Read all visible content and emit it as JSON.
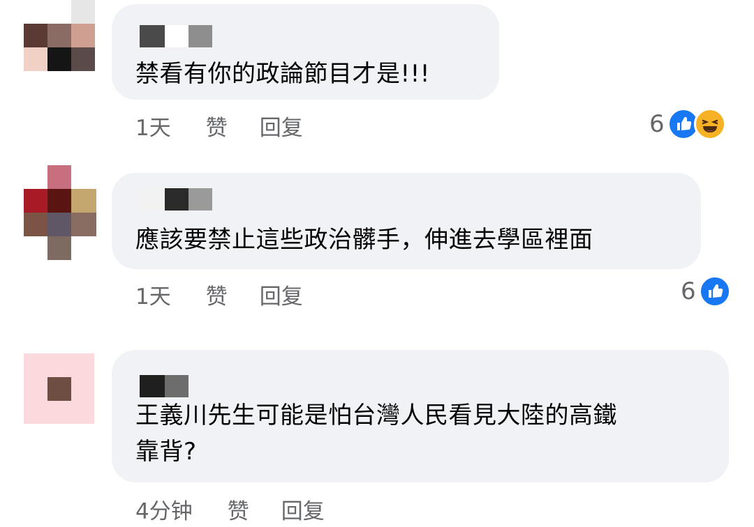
{
  "comments": [
    {
      "text": "禁看有你的政論節目才是!!!",
      "time": "1天",
      "like_label": "赞",
      "reply_label": "回复",
      "reaction_count": "6",
      "reactions": [
        "like-icon",
        "haha-icon"
      ]
    },
    {
      "text": "應該要禁止這些政治髒手，伸進去學區裡面",
      "time": "1天",
      "like_label": "赞",
      "reply_label": "回复",
      "reaction_count": "6",
      "reactions": [
        "like-icon"
      ]
    },
    {
      "text": "王義川先生可能是怕台灣人民看見大陸的高鐵\n靠背?",
      "time": "4分钟",
      "like_label": "赞",
      "reply_label": "回复"
    }
  ],
  "colors": {
    "bubble": "#f0f2f5",
    "meta_text": "#65676b",
    "like_blue": "#1877f2",
    "haha_yellow": "#f7b125"
  }
}
